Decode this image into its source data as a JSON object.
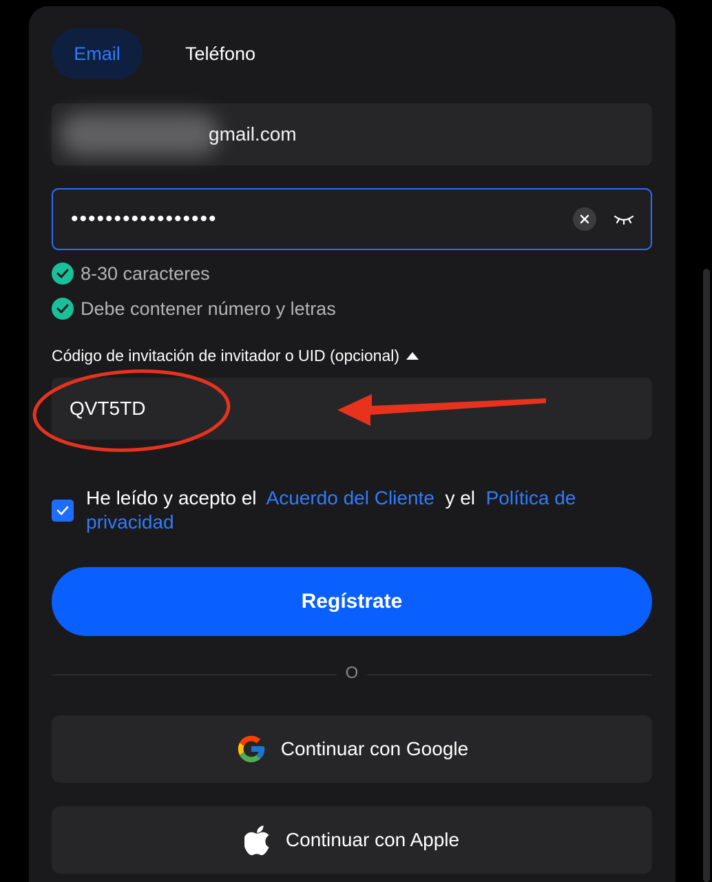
{
  "tabs": {
    "email": "Email",
    "phone": "Teléfono"
  },
  "email_field": {
    "value_suffix": "gmail.com"
  },
  "password_field": {
    "masked_value": "•••••••••••••••••"
  },
  "password_rules": [
    {
      "label": "8-30 caracteres",
      "satisfied": true
    },
    {
      "label": "Debe contener número y letras",
      "satisfied": true
    }
  ],
  "invite": {
    "label": "Código de invitación de invitador o UID (opcional)",
    "value": "QVT5TD"
  },
  "terms": {
    "checked": true,
    "prefix": "He leído y acepto el",
    "agreement_link": "Acuerdo del Cliente",
    "joiner": "y el",
    "privacy_link": "Política de privacidad"
  },
  "register_button": "Regístrate",
  "divider_text": "O",
  "social": {
    "google": "Continuar con Google",
    "apple": "Continuar con Apple"
  },
  "colors": {
    "accent": "#0a5fff",
    "link": "#2f7bff",
    "check_green": "#19c09a",
    "annotation_red": "#e8321e",
    "background": "#1a1a1c"
  }
}
